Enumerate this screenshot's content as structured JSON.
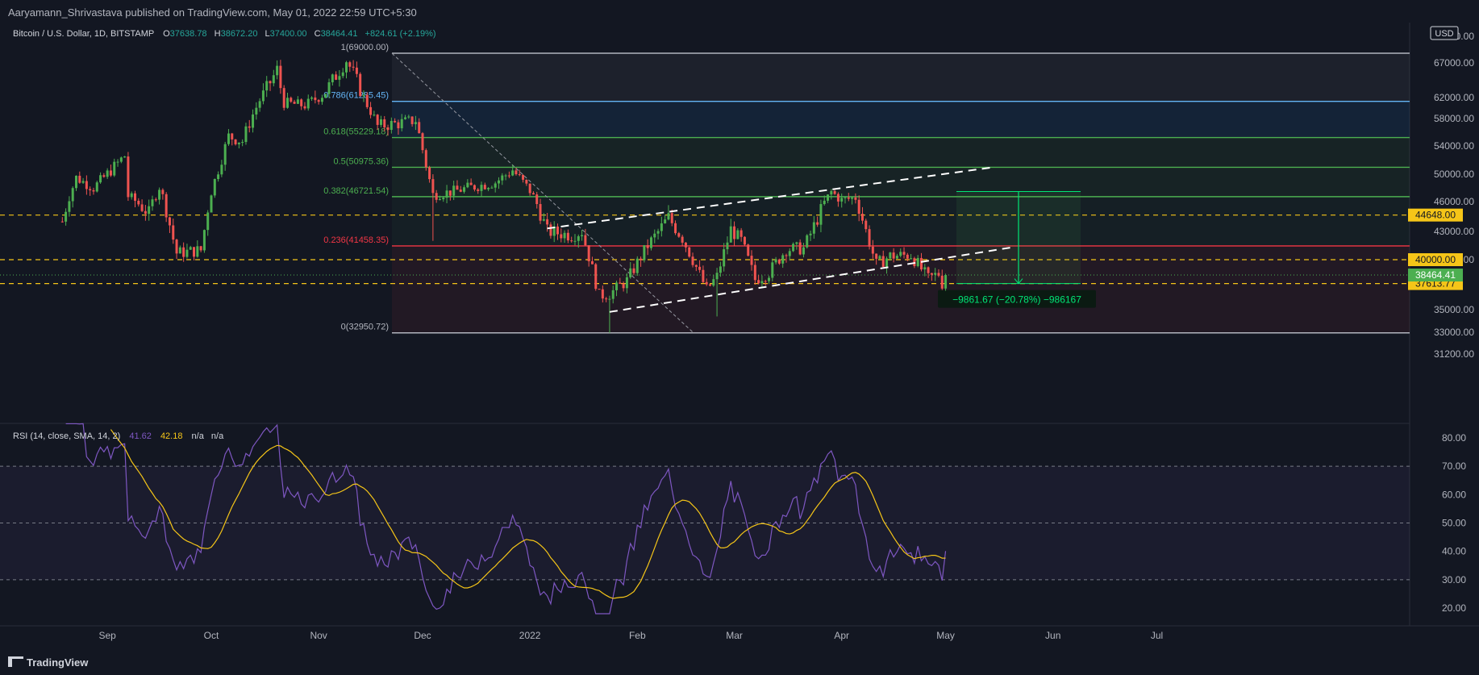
{
  "header": {
    "publish_line": "Aaryamann_Shrivastava published on TradingView.com, May 01, 2022 22:59 UTC+5:30"
  },
  "footer": {
    "brand": "TradingView"
  },
  "colors": {
    "background": "#131722",
    "up": "#26a69a",
    "up_bright": "#4caf50",
    "down": "#ef5350",
    "rsi_line": "#7e57c2",
    "rsi_sma": "#f5c518",
    "yellow_level": "#f5c518",
    "fib_white": "#b2b5be",
    "fib_blue": "#64b5f6",
    "fib_green": "#4caf50",
    "fib_red": "#f23645",
    "measure_green": "#00e676"
  },
  "chart_data": [
    {
      "type": "candlestick",
      "symbol_line": {
        "name": "Bitcoin / U.S. Dollar, 1D, BITSTAMP",
        "o_label": "O",
        "o": "37638.78",
        "h_label": "H",
        "h": "38672.20",
        "l_label": "L",
        "l": "37400.00",
        "c_label": "C",
        "c": "38464.41",
        "change": "+824.61 (+2.19%)"
      },
      "currency": "USD",
      "y_ticks": [
        "72000.00",
        "67000.00",
        "62000.00",
        "58000.00",
        "54000.00",
        "50000.00",
        "46000.00",
        "43000.00",
        "40000.00",
        "35000.00",
        "33000.00",
        "31200.00"
      ],
      "x_ticks": [
        "Sep",
        "Oct",
        "Nov",
        "Dec",
        "2022",
        "Feb",
        "Mar",
        "Apr",
        "May",
        "Jun",
        "Jul"
      ],
      "ohlc_anchors": [
        [
          "2021-08-19",
          44000
        ],
        [
          "2021-08-23",
          49500
        ],
        [
          "2021-08-28",
          48000
        ],
        [
          "2021-09-06",
          52600
        ],
        [
          "2021-09-07",
          46800
        ],
        [
          "2021-09-13",
          44800
        ],
        [
          "2021-09-16",
          48200
        ],
        [
          "2021-09-21",
          40700
        ],
        [
          "2021-09-28",
          41000
        ],
        [
          "2021-10-01",
          47500
        ],
        [
          "2021-10-06",
          55400
        ],
        [
          "2021-10-10",
          54700
        ],
        [
          "2021-10-15",
          61500
        ],
        [
          "2021-10-20",
          66000
        ],
        [
          "2021-10-22",
          61000
        ],
        [
          "2021-10-28",
          60500
        ],
        [
          "2021-11-03",
          62900
        ],
        [
          "2021-11-09",
          67500
        ],
        [
          "2021-11-12",
          64400
        ],
        [
          "2021-11-18",
          56900
        ],
        [
          "2021-11-24",
          57300
        ],
        [
          "2021-11-29",
          57800
        ],
        [
          "2021-12-04",
          47000
        ],
        [
          "2021-12-10",
          47500
        ],
        [
          "2021-12-14",
          48000
        ],
        [
          "2021-12-22",
          48800
        ],
        [
          "2021-12-27",
          50600
        ],
        [
          "2022-01-01",
          47600
        ],
        [
          "2022-01-06",
          43000
        ],
        [
          "2022-01-13",
          42600
        ],
        [
          "2022-01-16",
          43000
        ],
        [
          "2022-01-21",
          36400
        ],
        [
          "2022-01-24",
          36600
        ],
        [
          "2022-01-29",
          37900
        ],
        [
          "2022-02-04",
          41500
        ],
        [
          "2022-02-10",
          44400
        ],
        [
          "2022-02-14",
          42300
        ],
        [
          "2022-02-21",
          37000
        ],
        [
          "2022-02-24",
          38300
        ],
        [
          "2022-02-28",
          43200
        ],
        [
          "2022-03-03",
          42000
        ],
        [
          "2022-03-07",
          38000
        ],
        [
          "2022-03-11",
          38700
        ],
        [
          "2022-03-16",
          41100
        ],
        [
          "2022-03-21",
          41200
        ],
        [
          "2022-03-25",
          44300
        ],
        [
          "2022-03-29",
          47400
        ],
        [
          "2022-04-01",
          46200
        ],
        [
          "2022-04-05",
          46600
        ],
        [
          "2022-04-11",
          39500
        ],
        [
          "2022-04-15",
          40400
        ],
        [
          "2022-04-21",
          40500
        ],
        [
          "2022-04-26",
          38100
        ],
        [
          "2022-04-29",
          38600
        ],
        [
          "2022-04-30",
          37640
        ],
        [
          "2022-05-01",
          38464
        ]
      ],
      "fib_levels": [
        {
          "label": "1(69000.00)",
          "value": 69000
        },
        {
          "label": "0.786(61285.45)",
          "value": 61285.45
        },
        {
          "label": "0.618(55229.18)",
          "value": 55229.18
        },
        {
          "label": "0.5(50975.36)",
          "value": 50975.36
        },
        {
          "label": "0.382(46721.54)",
          "value": 46721.54
        },
        {
          "label": "0.236(41458.35)",
          "value": 41458.35
        },
        {
          "label": "0(32950.72)",
          "value": 32950.72
        }
      ],
      "horizontal_levels": [
        {
          "label": "44648.00",
          "value": 44648
        },
        {
          "label": "40000.00",
          "value": 40000
        },
        {
          "label": "37613.77",
          "value": 37613.77
        }
      ],
      "last_price": {
        "label": "38464.41",
        "value": 38464.41
      },
      "measurement": {
        "text": "−9861.67 (−20.78%) −986167",
        "from": 47475,
        "to": 37613.77
      },
      "trend_channel": {
        "upper": [
          [
            "2022-01-06",
            43300
          ],
          [
            "2022-05-15",
            51000
          ]
        ],
        "lower": [
          [
            "2022-01-24",
            34800
          ],
          [
            "2022-05-20",
            41300
          ]
        ]
      }
    },
    {
      "type": "line",
      "indicator_label": "RSI (14, close, SMA, 14, 2)",
      "rsi_value": "41.62",
      "sma_value": "42.18",
      "extra1": "n/a",
      "extra2": "n/a",
      "y_ticks": [
        "80.00",
        "70.00",
        "60.00",
        "50.00",
        "40.00",
        "30.00",
        "20.00"
      ],
      "bands": [
        70,
        50,
        30
      ]
    }
  ]
}
